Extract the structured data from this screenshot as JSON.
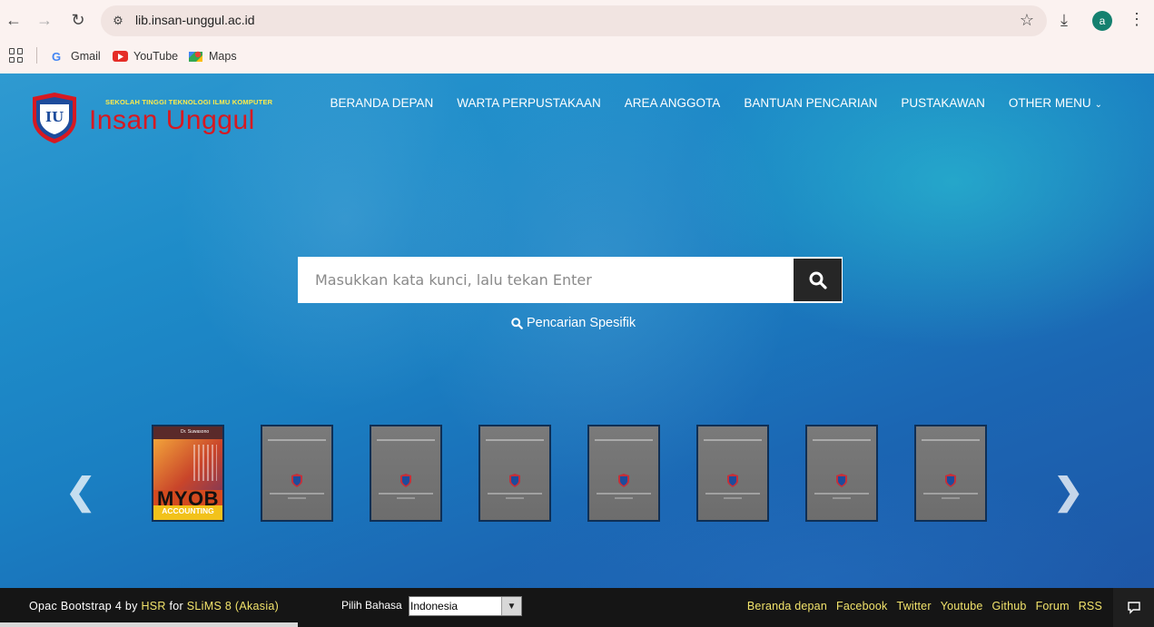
{
  "browser": {
    "url": "lib.insan-unggul.ac.id",
    "profile_initial": "a",
    "bookmarks": [
      {
        "label": "Gmail",
        "icon": "google-icon"
      },
      {
        "label": "YouTube",
        "icon": "youtube-icon"
      },
      {
        "label": "Maps",
        "icon": "maps-icon"
      }
    ]
  },
  "header": {
    "logo_tagline": "SEKOLAH TINGGI TEKNOLOGI ILMU KOMPUTER",
    "logo_brand": "Insan Unggul",
    "logo_badge": "IU",
    "nav": [
      {
        "label": "BERANDA DEPAN"
      },
      {
        "label": "WARTA PERPUSTAKAAN"
      },
      {
        "label": "AREA ANGGOTA"
      },
      {
        "label": "BANTUAN PENCARIAN"
      },
      {
        "label": "PUSTAKAWAN"
      },
      {
        "label": "OTHER MENU"
      }
    ]
  },
  "search": {
    "placeholder": "Masukkan kata kunci, lalu tekan Enter",
    "advanced_label": "Pencarian Spesifik"
  },
  "carousel": {
    "books": [
      {
        "title": "MYOB",
        "subtitle": "ACCOUNTING",
        "cover": "myob"
      },
      {
        "cover": "placeholder"
      },
      {
        "cover": "placeholder"
      },
      {
        "cover": "placeholder"
      },
      {
        "cover": "placeholder"
      },
      {
        "cover": "placeholder"
      },
      {
        "cover": "placeholder"
      },
      {
        "cover": "placeholder"
      }
    ]
  },
  "footer": {
    "credit_prefix": "Opac Bootstrap 4 by ",
    "credit_author": "HSR",
    "credit_mid": " for ",
    "credit_product": "SLiMS 8 (Akasia)",
    "lang_label": "Pilih Bahasa",
    "lang_value": "Indonesia",
    "links": [
      "Beranda depan",
      "Facebook",
      "Twitter",
      "Youtube",
      "Github",
      "Forum",
      "RSS"
    ]
  },
  "colors": {
    "brand_red": "#d71921",
    "link_yellow": "#f2e36b",
    "page_blue": "#1a7fc2"
  }
}
